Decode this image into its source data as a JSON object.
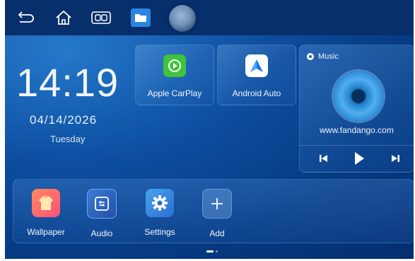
{
  "statusbar": {
    "icons": [
      "back-icon",
      "home-icon",
      "multiwindow-icon",
      "folder-icon",
      "assistant-orb-icon"
    ]
  },
  "clock": {
    "time": "14:19",
    "date": "04/14/2026",
    "day": "Tuesday"
  },
  "apps": [
    {
      "label": "Apple CarPlay",
      "icon": "carplay-icon",
      "color": "#3fc43a"
    },
    {
      "label": "Android Auto",
      "icon": "android-auto-icon",
      "color": "#ffffff"
    }
  ],
  "music": {
    "title": "Music",
    "source": "www.fandango.com",
    "controls": [
      "previous-icon",
      "play-icon",
      "next-icon"
    ]
  },
  "dock": [
    {
      "label": "Wallpaper",
      "icon": "wallpaper-icon"
    },
    {
      "label": "Audio",
      "icon": "audio-icon"
    },
    {
      "label": "Settings",
      "icon": "settings-icon"
    },
    {
      "label": "Add",
      "icon": "add-icon"
    }
  ],
  "colors": {
    "accent": "#2c86e0",
    "background": "#0d4ea0",
    "statusbar": "#072f6c"
  }
}
